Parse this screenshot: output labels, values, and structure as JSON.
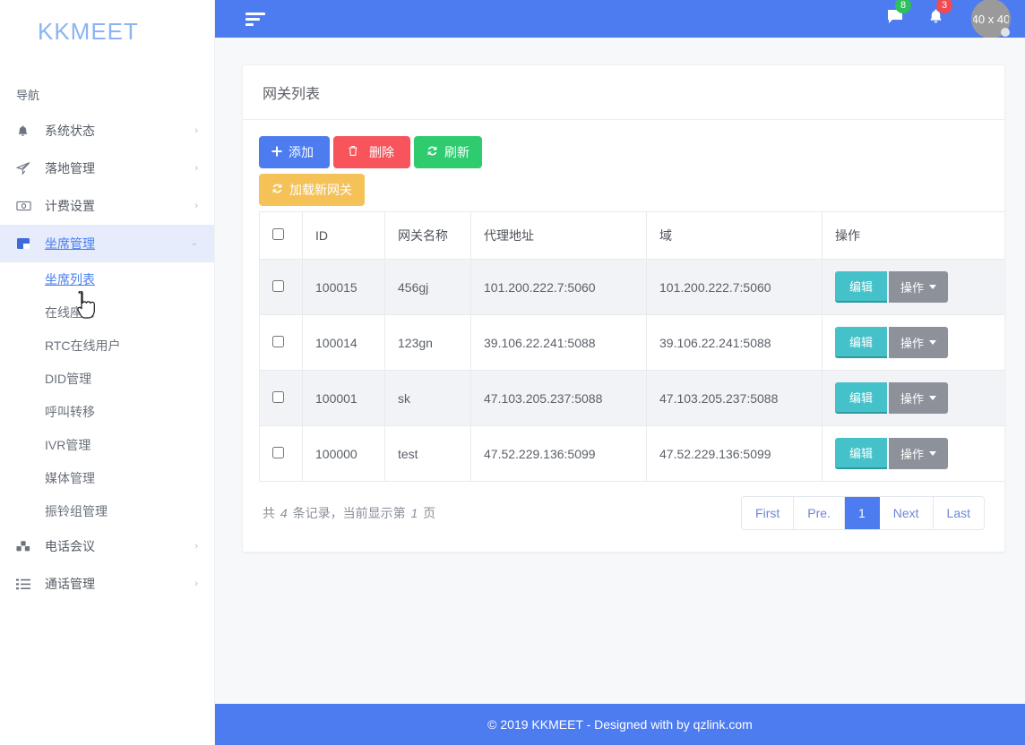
{
  "brand": {
    "name": "KKMEET"
  },
  "sidebar": {
    "nav_title": "导航",
    "items": [
      {
        "label": "系统状态",
        "icon": "bell-icon",
        "caret": "›"
      },
      {
        "label": "落地管理",
        "icon": "paper-plane-icon",
        "caret": "›"
      },
      {
        "label": "计费设置",
        "icon": "money-bill-icon",
        "caret": "›"
      },
      {
        "label": "坐席管理",
        "icon": "columns-icon",
        "caret": "⌄",
        "active": true
      }
    ],
    "sub_items": [
      {
        "label": "坐席列表",
        "current": true
      },
      {
        "label": "在线座席"
      },
      {
        "label": "RTC在线用户"
      },
      {
        "label": "DID管理"
      },
      {
        "label": "呼叫转移"
      },
      {
        "label": "IVR管理"
      },
      {
        "label": "媒体管理"
      },
      {
        "label": "振铃组管理"
      }
    ],
    "items_bottom": [
      {
        "label": "电话会议",
        "icon": "cubes-icon",
        "caret": "›"
      },
      {
        "label": "通话管理",
        "icon": "list-icon",
        "caret": "›"
      }
    ]
  },
  "topbar": {
    "menu_icon": "hamburger-filter-icon",
    "chat_icon": "chat-icon",
    "chat_badge": "8",
    "bell_icon": "bell-icon",
    "bell_badge": "3",
    "avatar_label": "40 x 40"
  },
  "card": {
    "title": "网关列表",
    "buttons": [
      {
        "label": "添加",
        "icon": "plus-icon",
        "color": "#4c7cf0"
      },
      {
        "label": "删除",
        "icon": "trash-icon",
        "color": "#f8545c"
      },
      {
        "label": "刷新",
        "icon": "refresh-icon",
        "color": "#2ecc6f"
      },
      {
        "label": "加载新网关",
        "icon": "refresh-icon",
        "color": "#f5c258"
      }
    ]
  },
  "table": {
    "columns": [
      "",
      "ID",
      "网关名称",
      "代理地址",
      "域",
      "操作"
    ],
    "rows": [
      {
        "id": "100015",
        "name": "456gj",
        "proxy": "101.200.222.7:5060",
        "domain": "101.200.222.7:5060",
        "edit": "编辑",
        "ops": "操作"
      },
      {
        "id": "100014",
        "name": "123gn",
        "proxy": "39.106.22.241:5088",
        "domain": "39.106.22.241:5088",
        "edit": "编辑",
        "ops": "操作"
      },
      {
        "id": "100001",
        "name": "sk",
        "proxy": "47.103.205.237:5088",
        "domain": "47.103.205.237:5088",
        "edit": "编辑",
        "ops": "操作"
      },
      {
        "id": "100000",
        "name": "test",
        "proxy": "47.52.229.136:5099",
        "domain": "47.52.229.136:5099",
        "edit": "编辑",
        "ops": "操作"
      }
    ]
  },
  "record_info": {
    "prefix": "共",
    "count": "4",
    "middle": "条记录，当前显示第",
    "page": "1",
    "suffix": "页"
  },
  "pagination": {
    "first": "First",
    "prev": "Pre.",
    "current": "1",
    "next": "Next",
    "last": "Last"
  },
  "footer": {
    "text": "© 2019 KKMEET - Designed with by qzlink.com"
  },
  "colors": {
    "brand_blue": "#4c7cf0",
    "sidebar_active": "#e6ecfb",
    "teal": "#45c2c9",
    "gray_btn": "#8d9199",
    "badge_green": "#2fbf5c",
    "badge_red": "#f04a53",
    "page_bg": "#f7f8fa"
  }
}
